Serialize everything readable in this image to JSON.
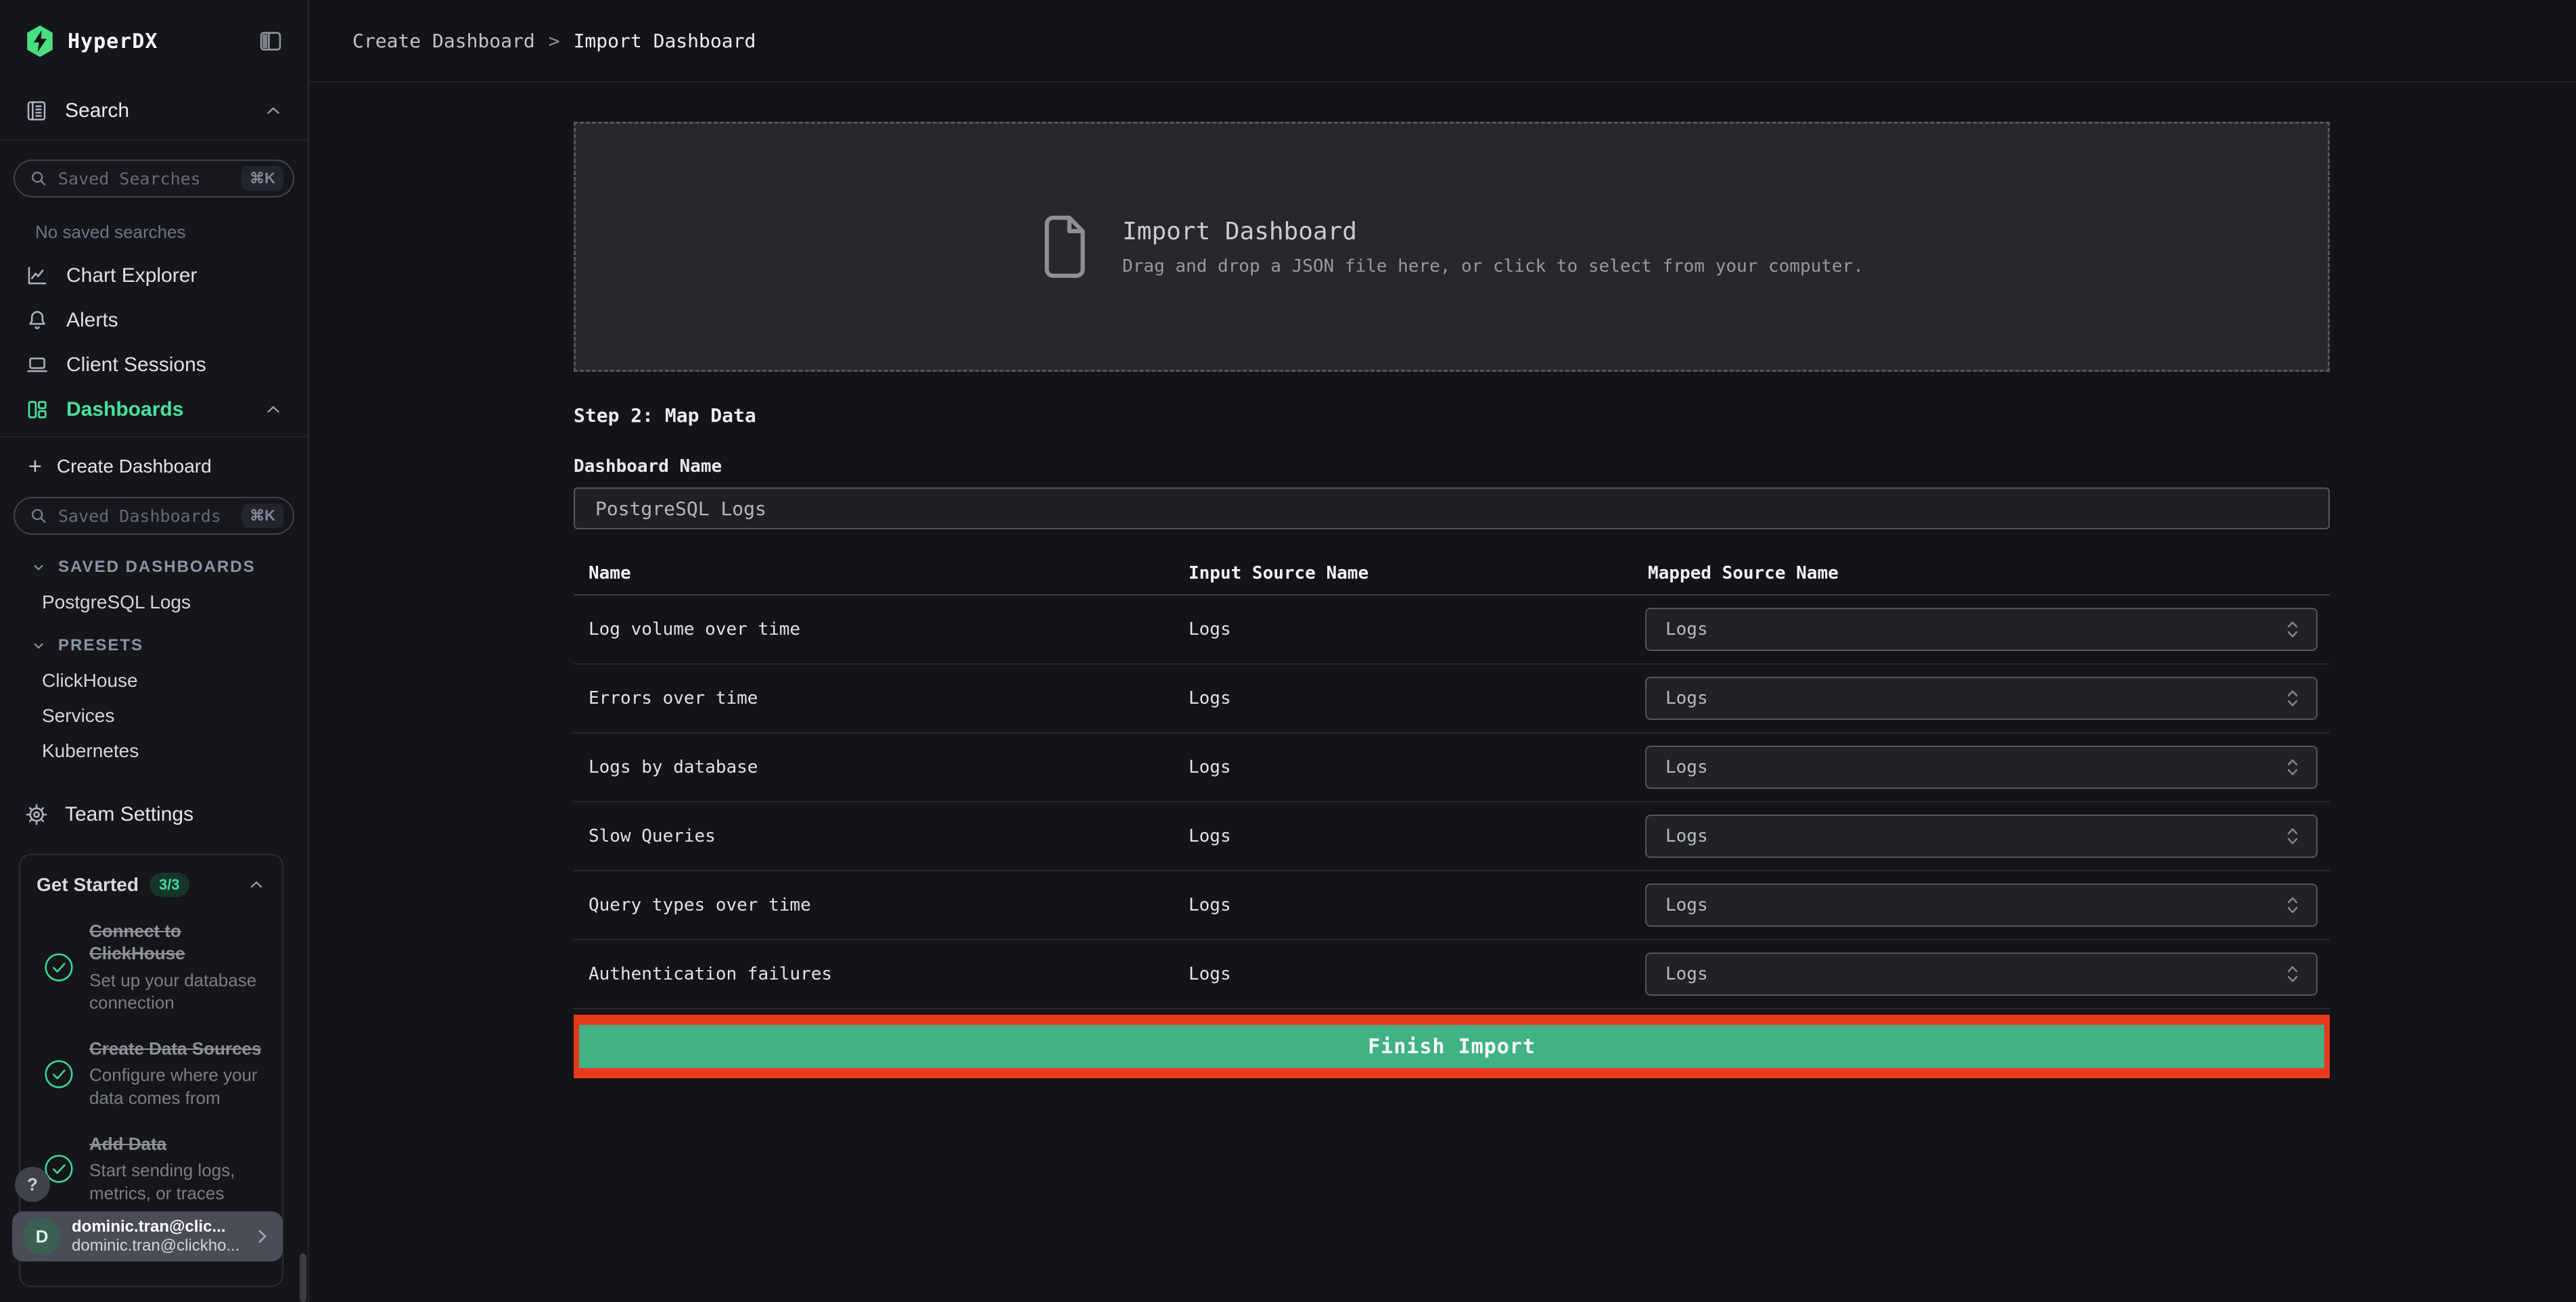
{
  "app": {
    "brand": "HyperDX"
  },
  "topbar": {
    "breadcrumb": {
      "parent": "Create Dashboard",
      "separator": ">",
      "current": "Import Dashboard"
    }
  },
  "sidebar": {
    "search": {
      "label": "Search",
      "placeholder": "Saved Searches",
      "shortcut": "⌘K",
      "empty": "No saved searches"
    },
    "nav": [
      {
        "label": "Chart Explorer"
      },
      {
        "label": "Alerts"
      },
      {
        "label": "Client Sessions"
      },
      {
        "label": "Dashboards",
        "active": true
      }
    ],
    "create_dashboard": {
      "plus": "+",
      "label": "Create Dashboard"
    },
    "dash_search": {
      "placeholder": "Saved Dashboards",
      "shortcut": "⌘K"
    },
    "saved_dashboards": {
      "header": "SAVED DASHBOARDS",
      "items": [
        "PostgreSQL Logs"
      ]
    },
    "presets": {
      "header": "PRESETS",
      "items": [
        "ClickHouse",
        "Services",
        "Kubernetes"
      ]
    },
    "team_settings": "Team Settings",
    "get_started": {
      "title": "Get Started",
      "badge": "3/3",
      "items": [
        {
          "title": "Connect to ClickHouse",
          "description": "Set up your database connection"
        },
        {
          "title": "Create Data Sources",
          "description": "Configure where your data comes from"
        },
        {
          "title": "Add Data",
          "description": "Start sending logs, metrics, or traces"
        }
      ]
    },
    "help_label": "?",
    "user": {
      "initial": "D",
      "name": "dominic.tran@clic...",
      "email": "dominic.tran@clickho..."
    }
  },
  "main": {
    "dropzone": {
      "title": "Import Dashboard",
      "description": "Drag and drop a JSON file here, or click to select from your computer."
    },
    "step_heading": "Step 2: Map Data",
    "dashboard_name": {
      "label": "Dashboard Name",
      "value": "PostgreSQL Logs"
    },
    "table": {
      "columns": [
        "Name",
        "Input Source Name",
        "Mapped Source Name"
      ],
      "rows": [
        {
          "name": "Log volume over time",
          "input_source": "Logs",
          "mapped_source": "Logs"
        },
        {
          "name": "Errors over time",
          "input_source": "Logs",
          "mapped_source": "Logs"
        },
        {
          "name": "Logs by database",
          "input_source": "Logs",
          "mapped_source": "Logs"
        },
        {
          "name": "Slow Queries",
          "input_source": "Logs",
          "mapped_source": "Logs"
        },
        {
          "name": "Query types over time",
          "input_source": "Logs",
          "mapped_source": "Logs"
        },
        {
          "name": "Authentication failures",
          "input_source": "Logs",
          "mapped_source": "Logs"
        }
      ]
    },
    "finish_button": "Finish Import"
  },
  "colors": {
    "accent_green": "#47e2a0",
    "button_green": "#40b283",
    "annotation_red": "#e8391c",
    "badge_green_bg": "#173529"
  }
}
